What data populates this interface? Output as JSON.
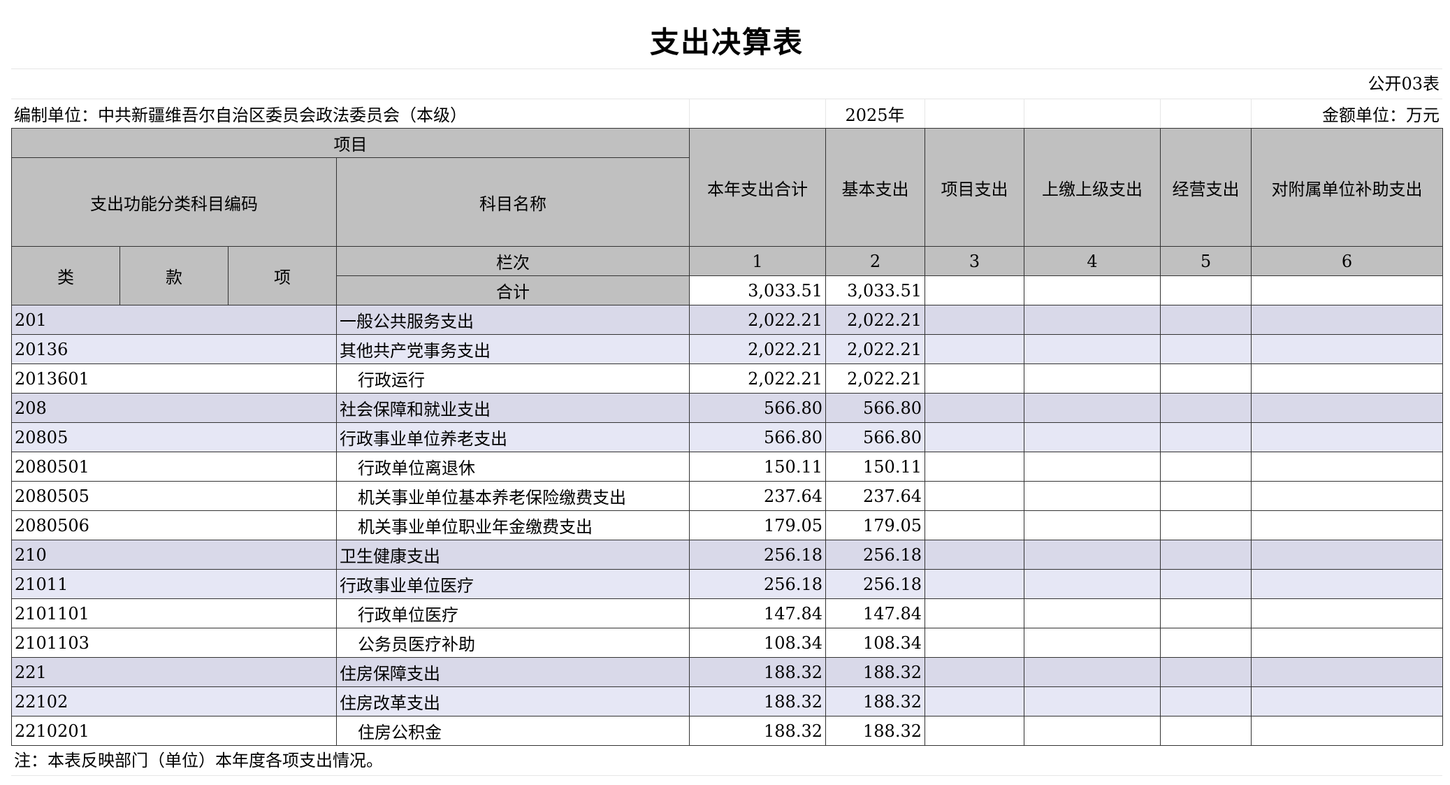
{
  "title": "支出决算表",
  "form_no": "公开03表",
  "unit_label": "编制单位：中共新疆维吾尔自治区委员会政法委员会（本级）",
  "year": "2025年",
  "amount_unit": "金额单位：万元",
  "headers": {
    "item": "项目",
    "code": "支出功能分类科目编码",
    "name": "科目名称",
    "lei": "类",
    "kuan": "款",
    "xiang": "项",
    "lanci": "栏次",
    "heji": "合计",
    "cols": [
      "本年支出合计",
      "基本支出",
      "项目支出",
      "上缴上级支出",
      "经营支出",
      "对附属单位补助支出"
    ],
    "col_nums": [
      "1",
      "2",
      "3",
      "4",
      "5",
      "6"
    ]
  },
  "total": {
    "c1": "3,033.51",
    "c2": "3,033.51"
  },
  "rows": [
    {
      "code": "201",
      "name": "一般公共服务支出",
      "c1": "2,022.21",
      "c2": "2,022.21"
    },
    {
      "code": "20136",
      "name": "其他共产党事务支出",
      "c1": "2,022.21",
      "c2": "2,022.21"
    },
    {
      "code": "2013601",
      "name": "行政运行",
      "c1": "2,022.21",
      "c2": "2,022.21"
    },
    {
      "code": "208",
      "name": "社会保障和就业支出",
      "c1": "566.80",
      "c2": "566.80"
    },
    {
      "code": "20805",
      "name": "行政事业单位养老支出",
      "c1": "566.80",
      "c2": "566.80"
    },
    {
      "code": "2080501",
      "name": "行政单位离退休",
      "c1": "150.11",
      "c2": "150.11"
    },
    {
      "code": "2080505",
      "name": "机关事业单位基本养老保险缴费支出",
      "c1": "237.64",
      "c2": "237.64"
    },
    {
      "code": "2080506",
      "name": "机关事业单位职业年金缴费支出",
      "c1": "179.05",
      "c2": "179.05"
    },
    {
      "code": "210",
      "name": "卫生健康支出",
      "c1": "256.18",
      "c2": "256.18"
    },
    {
      "code": "21011",
      "name": "行政事业单位医疗",
      "c1": "256.18",
      "c2": "256.18"
    },
    {
      "code": "2101101",
      "name": "行政单位医疗",
      "c1": "147.84",
      "c2": "147.84"
    },
    {
      "code": "2101103",
      "name": "公务员医疗补助",
      "c1": "108.34",
      "c2": "108.34"
    },
    {
      "code": "221",
      "name": "住房保障支出",
      "c1": "188.32",
      "c2": "188.32"
    },
    {
      "code": "22102",
      "name": "住房改革支出",
      "c1": "188.32",
      "c2": "188.32"
    },
    {
      "code": "2210201",
      "name": "住房公积金",
      "c1": "188.32",
      "c2": "188.32"
    }
  ],
  "note": "注：本表反映部门（单位）本年度各项支出情况。"
}
